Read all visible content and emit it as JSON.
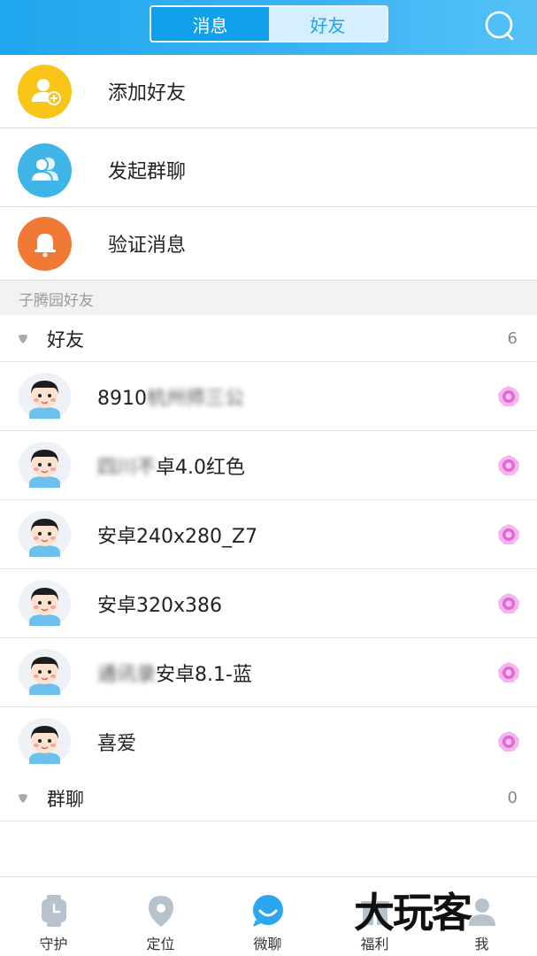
{
  "header": {
    "tabs": [
      {
        "label": "消息",
        "active": true
      },
      {
        "label": "好友",
        "active": false
      }
    ],
    "search_icon": "search-icon"
  },
  "actions": [
    {
      "label": "添加好友",
      "icon": "add-friend-icon",
      "color": "#f7c518"
    },
    {
      "label": "发起群聊",
      "icon": "group-chat-icon",
      "color": "#3fb4e6"
    },
    {
      "label": "验证消息",
      "icon": "bell-icon",
      "color": "#f07a35"
    }
  ],
  "section_title": "子腾园好友",
  "friends_group": {
    "label": "好友",
    "count": "6"
  },
  "friends": [
    {
      "name_visible": "8910",
      "name_blurred": "杭州师三公"
    },
    {
      "name_blurred": "四川不",
      "name_visible": "卓4.0红色"
    },
    {
      "name_visible": "安卓240x280_Z7"
    },
    {
      "name_visible": "安卓320x386"
    },
    {
      "name_blurred": "通讯录",
      "name_visible": "安卓8.1-蓝"
    },
    {
      "name_visible": "喜爱"
    }
  ],
  "groups_group": {
    "label": "群聊",
    "count": "0"
  },
  "tabbar": [
    {
      "label": "守护",
      "icon": "watch-icon"
    },
    {
      "label": "定位",
      "icon": "location-pin-icon"
    },
    {
      "label": "微聊",
      "icon": "chat-smile-icon",
      "active": true
    },
    {
      "label": "福利",
      "icon": "gift-icon"
    },
    {
      "label": "我",
      "icon": "profile-icon"
    }
  ],
  "watermark": "大玩客",
  "colors": {
    "accent": "#1fa6ee",
    "status_pink": "#e565d6",
    "active_tab": "#2aa7ee",
    "inactive_tab_icon": "#b8c2cc"
  }
}
